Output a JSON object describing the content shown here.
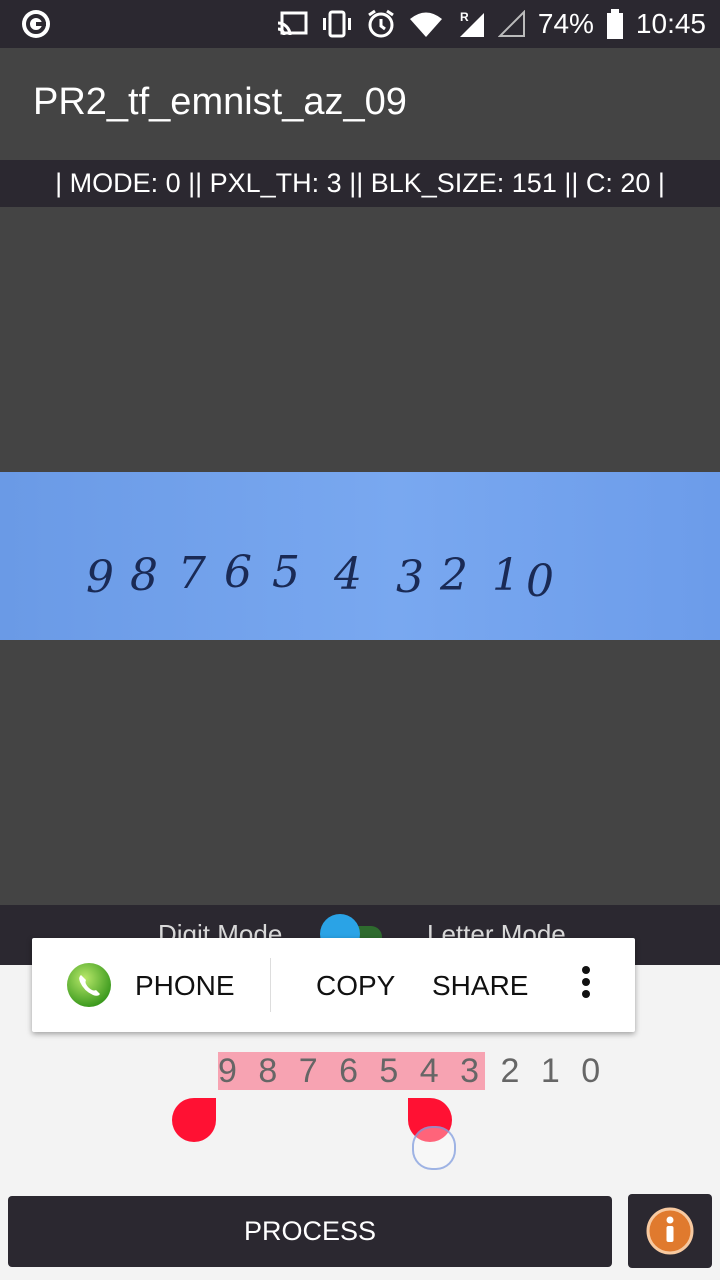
{
  "status_bar": {
    "battery_percent": "74%",
    "time": "10:45",
    "icons": [
      "g-logo-icon",
      "cast-icon",
      "vibrate-icon",
      "alarm-icon",
      "wifi-icon",
      "signal-roaming-icon",
      "signal-empty-icon",
      "battery-icon"
    ]
  },
  "app_bar": {
    "title": "PR2_tf_emnist_az_09"
  },
  "params_bar": {
    "text": "| MODE: 0 || PXL_TH: 3 || BLK_SIZE: 151 || C: 20  |"
  },
  "camera_preview": {
    "handwritten_digits": [
      "9",
      "8",
      "7",
      "6",
      "5",
      "4",
      "3",
      "2",
      "1",
      "0"
    ]
  },
  "mode_switch": {
    "left_label": "Digit Mode",
    "right_label": "Letter Mode",
    "selected": "Digit Mode"
  },
  "selection_popup": {
    "items": [
      {
        "label": "PHONE",
        "icon": "phone-app-icon"
      },
      {
        "label": "COPY"
      },
      {
        "label": "SHARE"
      }
    ],
    "more_icon": "more-vertical-icon"
  },
  "result": {
    "selected_text": "9 8 7 6 5 4 3",
    "unselected_text": " 2 1 0"
  },
  "buttons": {
    "process_label": "PROCESS",
    "info_icon": "info-icon"
  },
  "colors": {
    "dark_bar": "#2b2830",
    "preview_bg": "#444444",
    "paper_blue": "#79a8f0",
    "selection_highlight": "#f7a3b2",
    "handle_red": "#ff1133",
    "info_orange": "#e07a2e",
    "toggle_thumb": "#2aa3e6",
    "toggle_track": "#2e6b2e"
  }
}
